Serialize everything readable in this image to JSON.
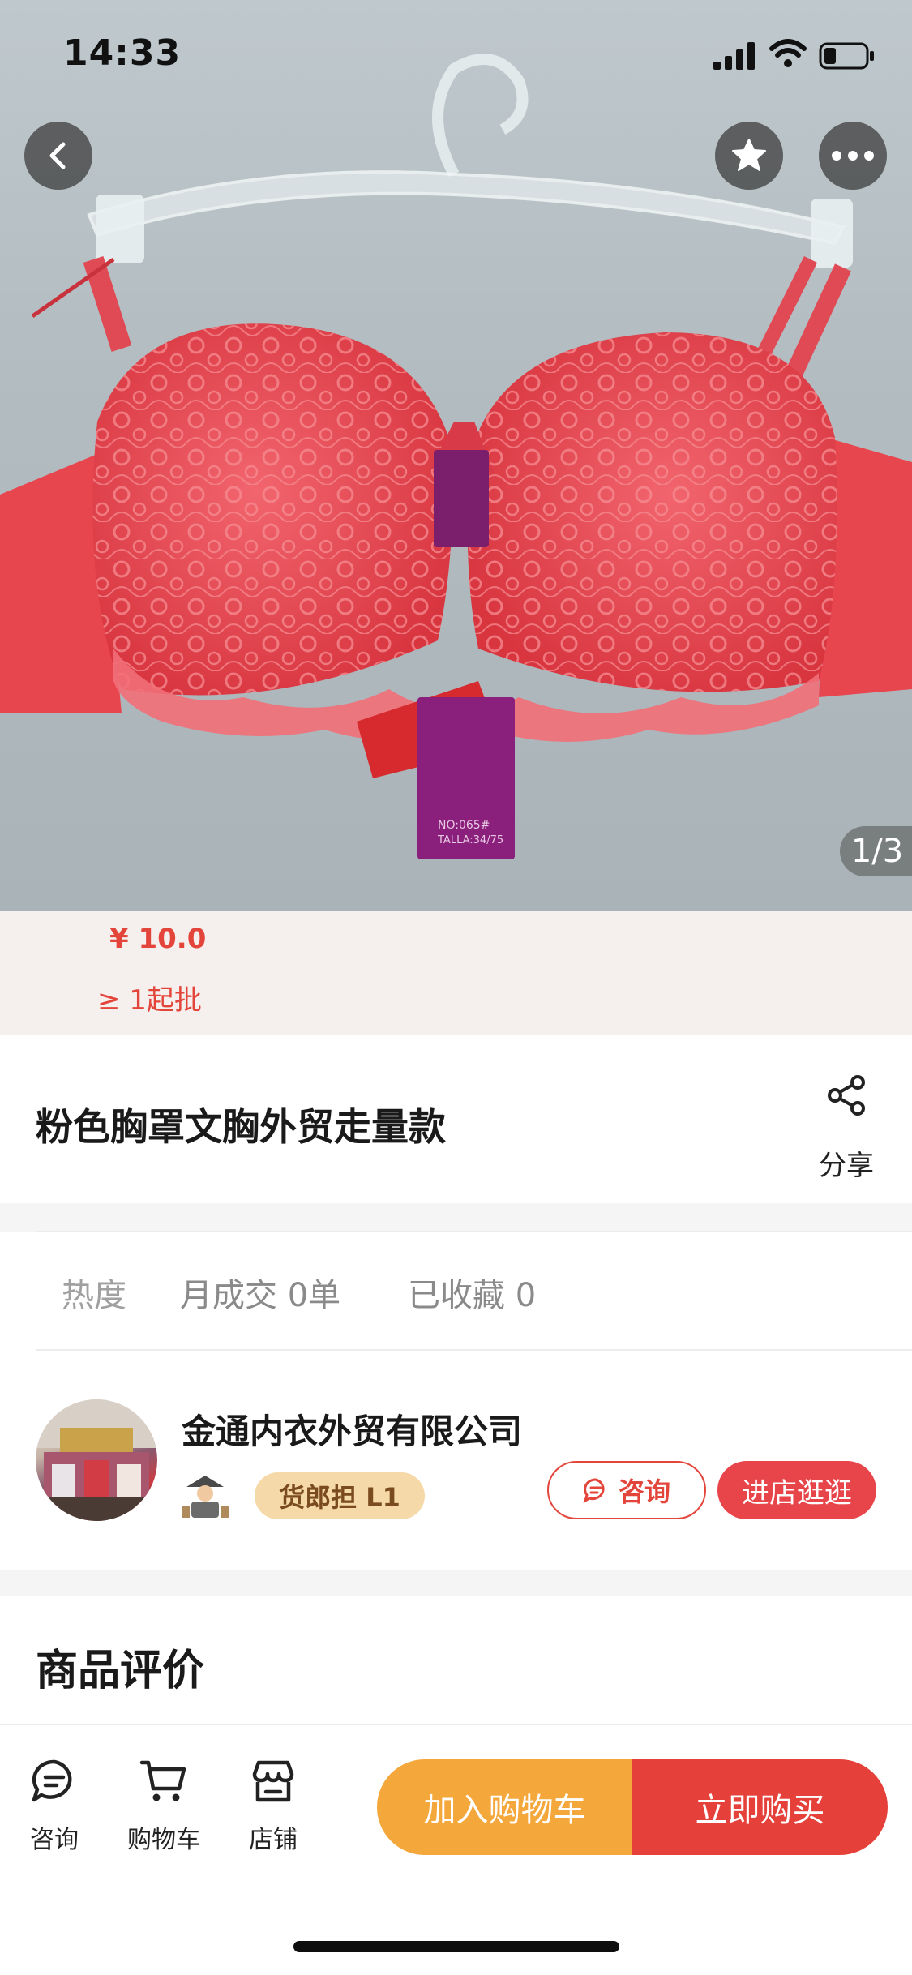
{
  "status_bar": {
    "time": "14:33"
  },
  "gallery": {
    "counter": "1/3",
    "image_description_icon": "product-photo"
  },
  "price": {
    "amount": "¥ 10.0",
    "min_order": "≥ 1起批"
  },
  "product": {
    "title": "粉色胸罩文胸外贸走量款",
    "share_label": "分享"
  },
  "stats": {
    "heat_label": "热度",
    "monthly_sales": "月成交 0单",
    "favorites": "已收藏 0"
  },
  "store": {
    "name": "金通内衣外贸有限公司",
    "level": "货郎担 L1",
    "consult_label": "咨询",
    "enter_label": "进店逛逛"
  },
  "reviews": {
    "title": "商品评价"
  },
  "bottom_bar": {
    "tabs": [
      {
        "label": "咨询",
        "icon": "chat-icon"
      },
      {
        "label": "购物车",
        "icon": "cart-icon"
      },
      {
        "label": "店铺",
        "icon": "store-icon"
      }
    ],
    "add_to_cart": "加入购物车",
    "buy_now": "立即购买"
  },
  "colors": {
    "accent_red": "#e3453b",
    "cart_orange": "#f4a73a",
    "badge_gold": "#f6d9a8"
  }
}
